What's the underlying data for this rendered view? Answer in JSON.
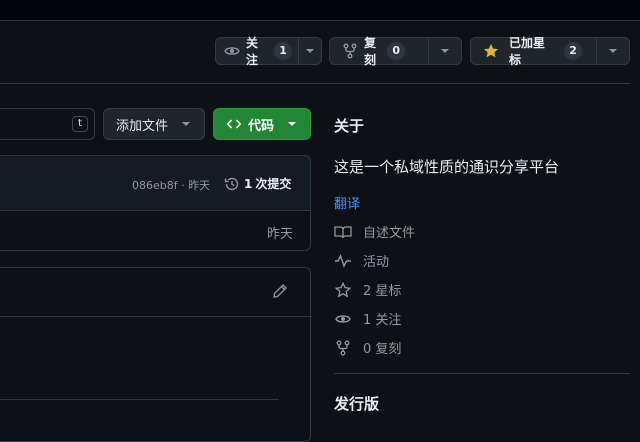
{
  "header": {
    "watch": {
      "label": "关注",
      "count": "1"
    },
    "fork": {
      "label": "复刻",
      "count": "0"
    },
    "star": {
      "label": "已加星标",
      "count": "2"
    }
  },
  "toolbar": {
    "shortcut_key": "t",
    "add_file_label": "添加文件",
    "code_label": "代码"
  },
  "commit_bar": {
    "hash_time": "086eb8f · 昨天",
    "commits_count": "1",
    "commits_label": "次提交"
  },
  "file_row": {
    "time": "昨天"
  },
  "about": {
    "heading": "关于",
    "description": "这是一个私域性质的通识分享平台",
    "translate_link": "翻译",
    "items": [
      {
        "icon": "book-icon",
        "label": "自述文件"
      },
      {
        "icon": "pulse-icon",
        "label": "活动"
      },
      {
        "icon": "star-icon",
        "label": "2 星标"
      },
      {
        "icon": "eye-icon",
        "label": "1 关注"
      },
      {
        "icon": "fork-icon",
        "label": "0 复刻"
      }
    ],
    "releases_heading": "发行版"
  },
  "colors": {
    "accent_green": "#238636",
    "link_blue": "#4493f8",
    "star_yellow": "#e3b341"
  }
}
